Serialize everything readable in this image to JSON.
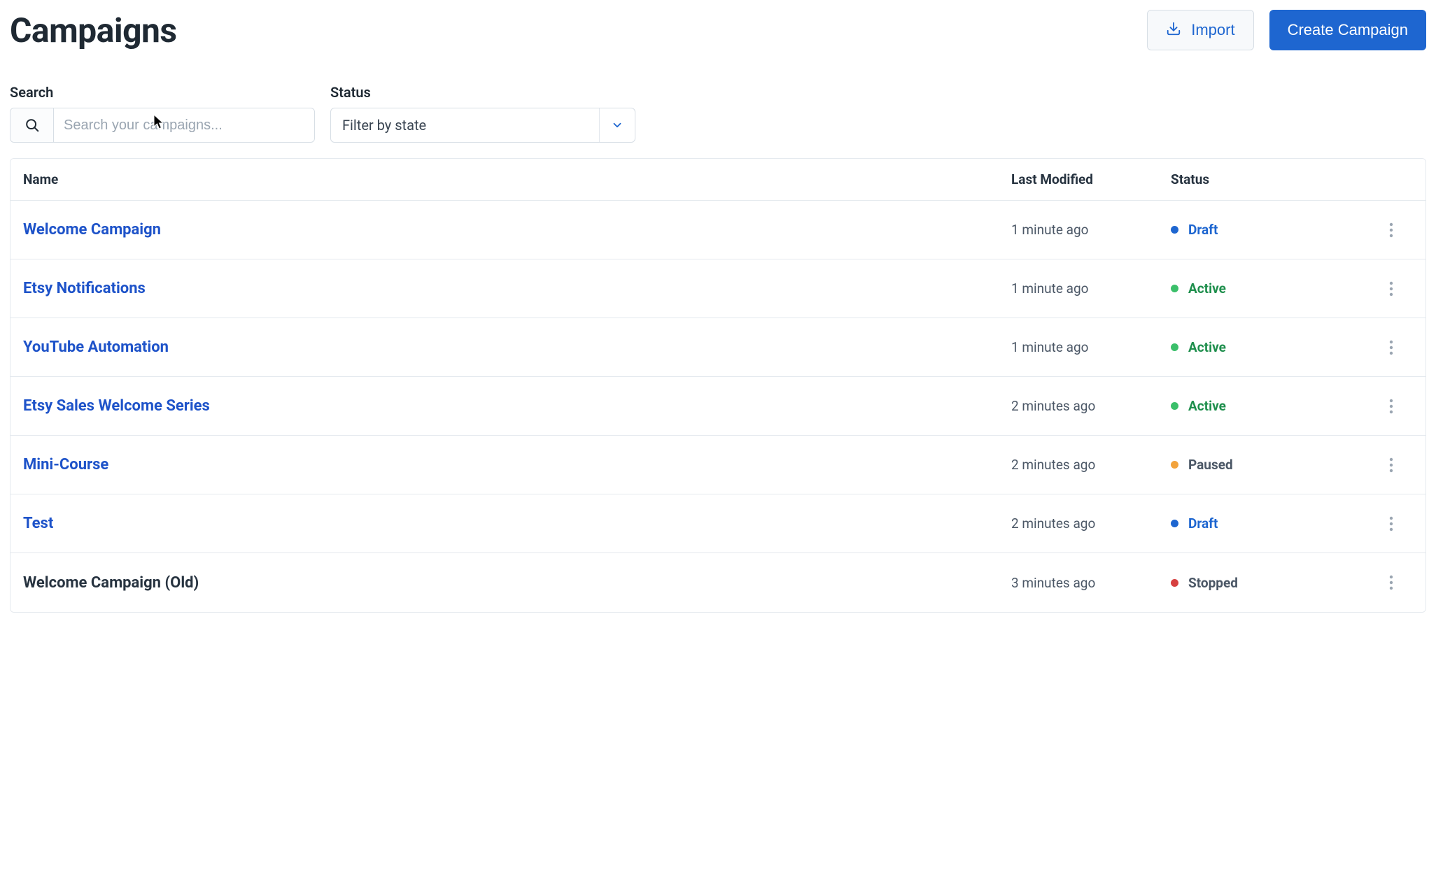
{
  "header": {
    "title": "Campaigns",
    "import_label": "Import",
    "create_label": "Create Campaign"
  },
  "filters": {
    "search_label": "Search",
    "search_placeholder": "Search your campaigns...",
    "status_label": "Status",
    "status_placeholder": "Filter by state"
  },
  "table": {
    "columns": {
      "name": "Name",
      "last_modified": "Last Modified",
      "status": "Status"
    }
  },
  "status_colors": {
    "Draft": {
      "dot": "#1e66d0",
      "text": "#1e66d0"
    },
    "Active": {
      "dot": "#3bbf6a",
      "text": "#1f8f4d"
    },
    "Paused": {
      "dot": "#f2a33c",
      "text": "#4b5766"
    },
    "Stopped": {
      "dot": "#d64040",
      "text": "#4b5766"
    }
  },
  "rows": [
    {
      "name": "Welcome Campaign",
      "modified": "1 minute ago",
      "status": "Draft",
      "link": true
    },
    {
      "name": "Etsy Notifications",
      "modified": "1 minute ago",
      "status": "Active",
      "link": true
    },
    {
      "name": "YouTube Automation",
      "modified": "1 minute ago",
      "status": "Active",
      "link": true
    },
    {
      "name": "Etsy Sales Welcome Series",
      "modified": "2 minutes ago",
      "status": "Active",
      "link": true
    },
    {
      "name": "Mini-Course",
      "modified": "2 minutes ago",
      "status": "Paused",
      "link": true
    },
    {
      "name": "Test",
      "modified": "2 minutes ago",
      "status": "Draft",
      "link": true
    },
    {
      "name": "Welcome Campaign (Old)",
      "modified": "3 minutes ago",
      "status": "Stopped",
      "link": false
    }
  ]
}
